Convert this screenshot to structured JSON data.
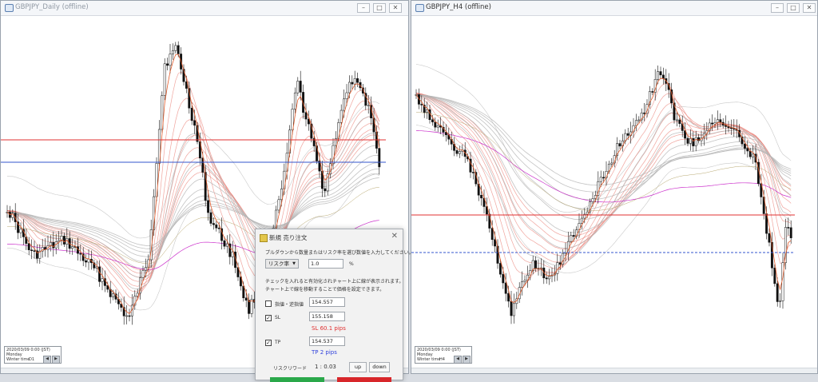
{
  "windows": {
    "left": {
      "title": "GBPJPY_Daily (offline)",
      "status": {
        "line1": "2020/03/09 0:00 (JST)",
        "line2": "Monday",
        "line3": "Winter time",
        "timeframe": "D1"
      }
    },
    "right": {
      "title": "GBPJPY_H4 (offline)",
      "status": {
        "line1": "2020/03/09 0:00 (JST)",
        "line2": "Monday",
        "line3": "Winter time",
        "timeframe": "H4"
      }
    }
  },
  "window_controls": {
    "minimize": "–",
    "maximize": "□",
    "close": "✕"
  },
  "dialog": {
    "title": "新規 売り注文",
    "close": "✕",
    "instruction": "プルダウンから数量またはリスク率を選び数値を入力してください。",
    "mode_select": "リスク率",
    "mode_value": "1.0",
    "percent_unit": "%",
    "note_line1": "チェックを入れると有効化されチャート上に線が表示されます。",
    "note_line2": "チャート上で線を移動することで価格を設定できます。",
    "entry": {
      "label": "指値・逆指値",
      "value": "154.557",
      "checked": false
    },
    "sl": {
      "label": "SL",
      "value": "155.158",
      "checked": true,
      "pips": "SL 60.1 pips"
    },
    "tp": {
      "label": "TP",
      "value": "154.537",
      "checked": true,
      "pips": "TP 2 pips"
    },
    "risk_reward_label": "リスクリワード",
    "risk_reward_value": "1 : 0.03",
    "up_button": "up",
    "down_button": "down"
  },
  "colors": {
    "sl_line": "#e03030",
    "entry_line": "#3355cc",
    "sl_pips": "#e03030",
    "tp_pips": "#3344dd",
    "candle": "#111111",
    "ema_red": "#e8756a",
    "ema_grey": "#b4b4b4",
    "magenta_ma": "#cc33cc"
  }
}
